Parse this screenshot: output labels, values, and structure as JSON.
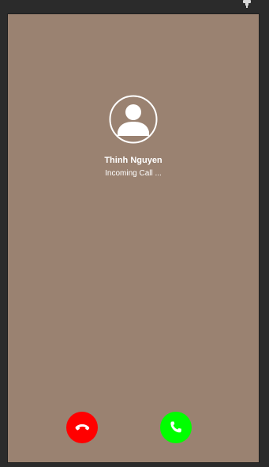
{
  "call": {
    "caller_name": "Thinh Nguyen",
    "status": "Incoming Call ..."
  },
  "icons": {
    "top_right": "pin-icon",
    "avatar": "person-icon",
    "decline": "phone-hangup-icon",
    "accept": "phone-icon"
  },
  "colors": {
    "background": "#9a8271",
    "decline": "#ff0000",
    "accept": "#00ff00",
    "text": "#ffffff"
  }
}
